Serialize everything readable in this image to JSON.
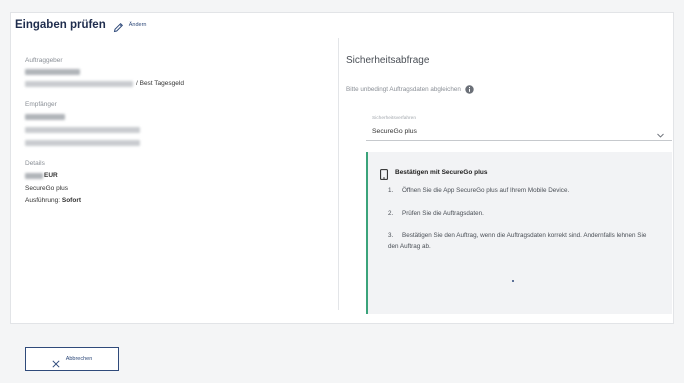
{
  "page": {
    "title": "Eingaben prüfen",
    "edit_label": "Ändern"
  },
  "summary": {
    "auftraggeber_label": "Auftraggeber",
    "auftraggeber_account_suffix": "/ Best Tagesgeld",
    "empfaenger_label": "Empfänger",
    "details_label": "Details",
    "currency": "EUR",
    "method": "SecureGo plus",
    "execution_label": "Ausführung:",
    "execution_value": "Sofort"
  },
  "security": {
    "title": "Sicherheitsabfrage",
    "hint": "Bitte unbedingt Auftragsdaten abgleichen",
    "select_label": "Sicherheitsverfahren",
    "select_value": "SecureGo plus",
    "panel_title": "Bestätigen mit SecureGo plus",
    "steps": [
      {
        "n": "1.",
        "text": "Öffnen Sie die App SecureGo plus auf Ihrem Mobile Device."
      },
      {
        "n": "2.",
        "text": "Prüfen Sie die Auftragsdaten."
      },
      {
        "n": "3.",
        "text": "Bestätigen Sie den Auftrag, wenn die Auftragsdaten korrekt sind. Andernfalls lehnen Sie den Auftrag ab."
      }
    ]
  },
  "footer": {
    "cancel_label": "Abbrechen"
  },
  "colors": {
    "primary": "#2f4a7a",
    "accent_green": "#3aa37a",
    "panel_bg": "#f2f3f5"
  },
  "icons": [
    "edit-pencil-icon",
    "info-icon",
    "chevron-down-icon",
    "smartphone-icon",
    "close-icon"
  ]
}
